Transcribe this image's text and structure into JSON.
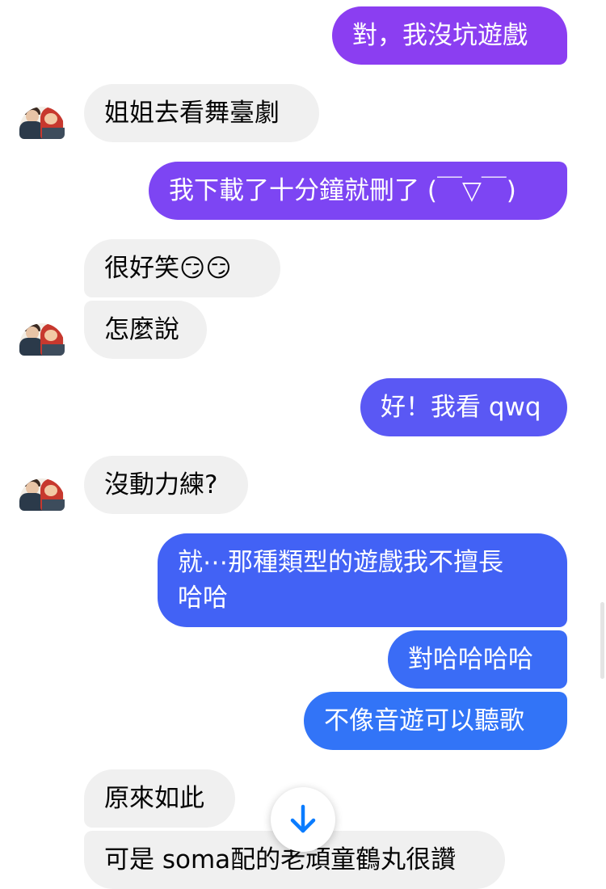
{
  "messages": [
    {
      "id": "m1",
      "text": "對，我沒坑遊戲",
      "direction": "sent"
    },
    {
      "id": "m2",
      "text": "姐姐去看舞臺劇",
      "direction": "received"
    },
    {
      "id": "m3",
      "text": "我下載了十分鐘就刪了 (￣▽￣)",
      "direction": "sent"
    },
    {
      "id": "m4",
      "text": "很好笑😏😏",
      "direction": "received"
    },
    {
      "id": "m5",
      "text": "怎麼說",
      "direction": "received"
    },
    {
      "id": "m6",
      "text": "好！我看 qwq",
      "direction": "sent"
    },
    {
      "id": "m7",
      "text": "沒動力練?",
      "direction": "received"
    },
    {
      "id": "m8",
      "text": "就⋯那種類型的遊戲我不擅長\n哈哈",
      "direction": "sent"
    },
    {
      "id": "m9",
      "text": "對哈哈哈哈",
      "direction": "sent"
    },
    {
      "id": "m10",
      "text": "不像音遊可以聽歌",
      "direction": "sent"
    },
    {
      "id": "m11",
      "text": "原來如此",
      "direction": "received"
    },
    {
      "id": "m12",
      "text": "可是 soma配的老頑童鶴丸很讚",
      "direction": "received"
    }
  ],
  "icons": {
    "scroll_down": "arrow-down-icon",
    "avatar": "contact-avatar"
  },
  "colors": {
    "sent_top": "#8a3ff0",
    "sent_bottom": "#2f78f6",
    "received_bg": "#f0f0f0",
    "scroll_arrow": "#0a7cff"
  }
}
